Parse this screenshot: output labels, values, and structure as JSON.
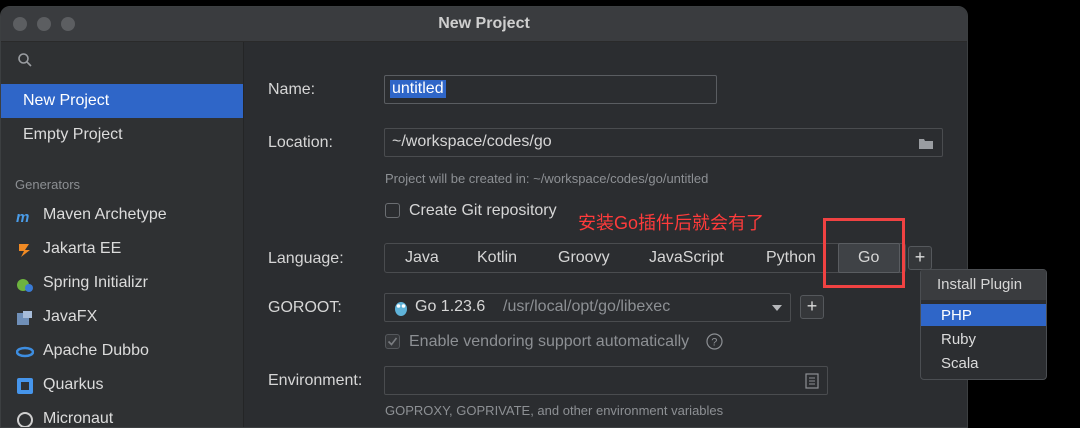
{
  "window": {
    "title": "New Project"
  },
  "sidebar": {
    "items": [
      {
        "label": "New Project",
        "selected": true
      },
      {
        "label": "Empty Project",
        "selected": false
      }
    ],
    "section_title": "Generators",
    "generators": [
      {
        "label": "Maven Archetype",
        "icon": "maven-icon"
      },
      {
        "label": "Jakarta EE",
        "icon": "jakarta-icon"
      },
      {
        "label": "Spring Initializr",
        "icon": "spring-icon"
      },
      {
        "label": "JavaFX",
        "icon": "javafx-icon"
      },
      {
        "label": "Apache Dubbo",
        "icon": "dubbo-icon"
      },
      {
        "label": "Quarkus",
        "icon": "quarkus-icon"
      },
      {
        "label": "Micronaut",
        "icon": "micronaut-icon"
      }
    ]
  },
  "form": {
    "name_label": "Name:",
    "name_value": "untitled",
    "location_label": "Location:",
    "location_value": "~/workspace/codes/go",
    "location_hint": "Project will be created in: ~/workspace/codes/go/untitled",
    "git_label": "Create Git repository",
    "language_label": "Language:",
    "languages": [
      "Java",
      "Kotlin",
      "Groovy",
      "JavaScript",
      "Python",
      "Go"
    ],
    "selected_language": "Go",
    "goroot_label": "GOROOT:",
    "goroot_value": "Go 1.23.6",
    "goroot_path": "/usr/local/opt/go/libexec",
    "vendoring_label": "Enable vendoring support automatically",
    "environment_label": "Environment:",
    "environment_hint": "GOPROXY, GOPRIVATE, and other environment variables"
  },
  "annotation": {
    "text": "安装Go插件后就会有了",
    "color": "#ff3b3b"
  },
  "popup": {
    "header": "Install Plugin",
    "items": [
      {
        "label": "PHP",
        "selected": true
      },
      {
        "label": "Ruby",
        "selected": false
      },
      {
        "label": "Scala",
        "selected": false
      }
    ]
  },
  "colors": {
    "accent": "#2f66c8",
    "annotation": "#f04242"
  }
}
